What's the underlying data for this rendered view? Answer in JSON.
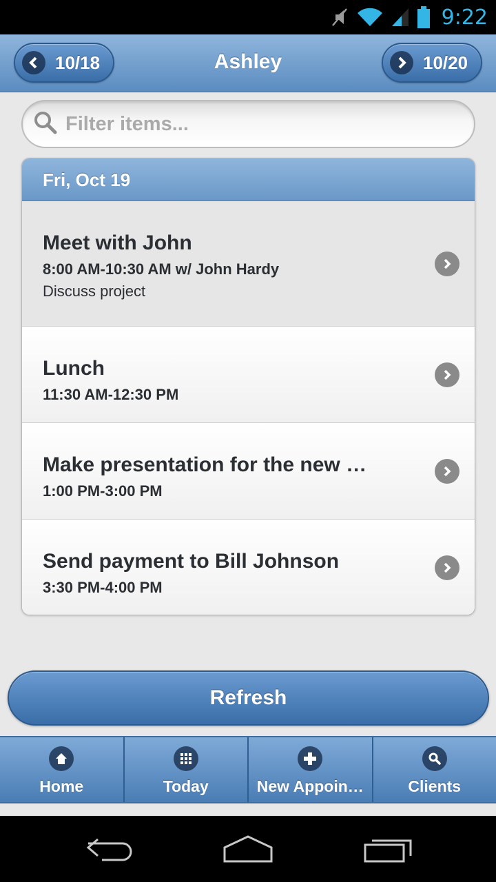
{
  "status_bar": {
    "time": "9:22",
    "icons": [
      "muted-icon",
      "wifi-icon",
      "signal-icon",
      "battery-icon"
    ]
  },
  "header": {
    "title": "Ashley",
    "prev_label": "10/18",
    "next_label": "10/20"
  },
  "search": {
    "placeholder": "Filter items..."
  },
  "list": {
    "day_label": "Fri, Oct 19",
    "items": [
      {
        "title": "Meet with John",
        "time": "8:00 AM-10:30 AM w/ John Hardy",
        "description": "Discuss project"
      },
      {
        "title": "Lunch",
        "time": "11:30 AM-12:30 PM"
      },
      {
        "title": "Make presentation for the new …",
        "time": "1:00 PM-3:00 PM"
      },
      {
        "title": "Send payment to Bill Johnson",
        "time": "3:30 PM-4:00 PM"
      }
    ]
  },
  "refresh_label": "Refresh",
  "footer": {
    "tabs": [
      {
        "label": "Home",
        "icon": "home-icon"
      },
      {
        "label": "Today",
        "icon": "grid-icon"
      },
      {
        "label": "New Appoin…",
        "icon": "plus-icon"
      },
      {
        "label": "Clients",
        "icon": "search-icon"
      }
    ]
  },
  "colors": {
    "accent": "#5b8cc0",
    "status_text": "#33b5e5",
    "text_dark": "#2b2f33"
  }
}
